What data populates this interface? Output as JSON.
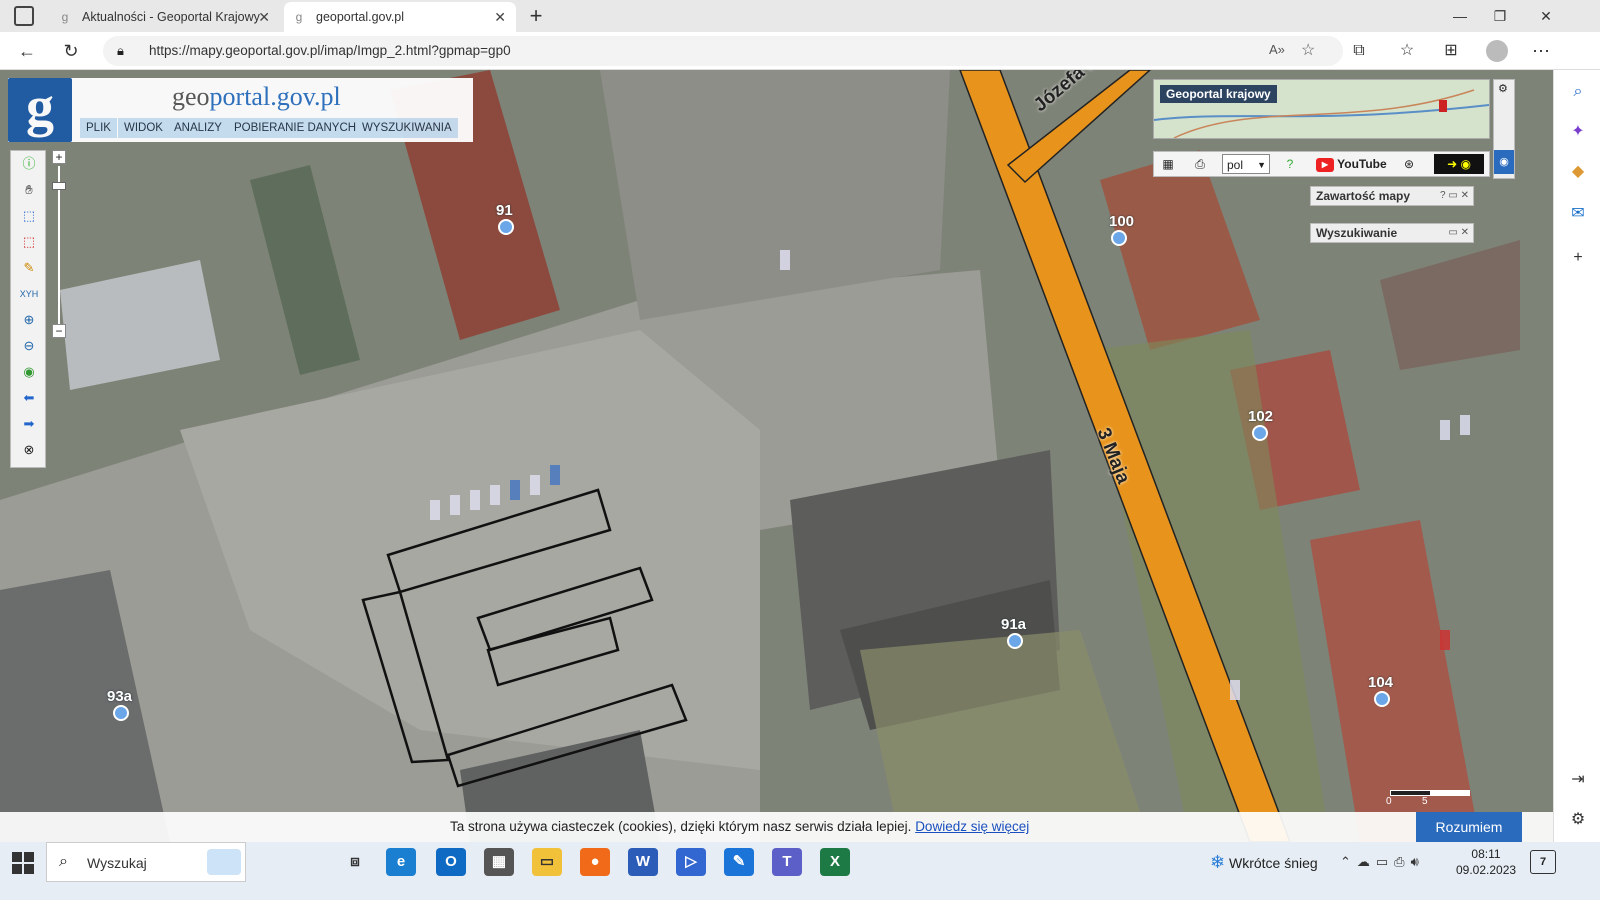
{
  "browser": {
    "tabs": [
      {
        "title": "Aktualności - Geoportal Krajowy"
      },
      {
        "title": "geoportal.gov.pl"
      }
    ],
    "url": "https://mapy.geoportal.gov.pl/imap/Imgp_2.html?gpmap=gp0"
  },
  "app": {
    "logo_letter": "g",
    "title_a": "geo",
    "title_b": "portal.gov.pl",
    "menu": [
      "PLIK",
      "WIDOK",
      "ANALIZY",
      "POBIERANIE DANYCH",
      "WYSZUKIWANIA"
    ]
  },
  "overview": {
    "title": "Geoportal krajowy"
  },
  "toolbar2": {
    "lang_value": "pol",
    "youtube_label": "YouTube"
  },
  "panels": {
    "map_content": "Zawartość mapy",
    "search": "Wyszukiwanie"
  },
  "markers": [
    {
      "label": "91"
    },
    {
      "label": "100"
    },
    {
      "label": "102"
    },
    {
      "label": "91a"
    },
    {
      "label": "93a"
    },
    {
      "label": "104"
    }
  ],
  "streets": {
    "street1": "Józefa Ryma",
    "street2": "3 Maja"
  },
  "scale": {
    "start": "0",
    "mid": "5"
  },
  "cookie": {
    "text": "Ta strona używa ciasteczek (cookies), dzięki którym nasz serwis działa lepiej.",
    "link": "Dowiedz się więcej",
    "accept": "Rozumiem"
  },
  "taskbar": {
    "search_placeholder": "Wyszukaj",
    "weather": "Wkrótce śnieg",
    "time": "08:11",
    "date": "09.02.2023",
    "notifications": "7"
  },
  "colors": {
    "road": "#e8941c",
    "accent": "#2b6bbd"
  }
}
